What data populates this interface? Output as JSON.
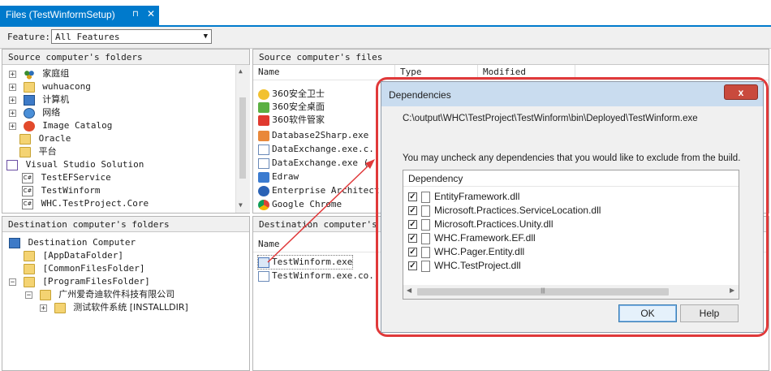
{
  "tab": {
    "title": "Files (TestWinformSetup)",
    "pin": "⊓",
    "close": "✕"
  },
  "feature": {
    "label": "Feature:",
    "value": "All Features"
  },
  "source_folders": {
    "header": "Source computer's folders",
    "items": [
      {
        "label": "家庭组",
        "expand": "+",
        "icon": "homegroup-icon"
      },
      {
        "label": "wuhuacong",
        "expand": "+",
        "icon": "user-icon"
      },
      {
        "label": "计算机",
        "expand": "+",
        "icon": "computer-icon"
      },
      {
        "label": "网络",
        "expand": "+",
        "icon": "network-icon"
      },
      {
        "label": "Image Catalog",
        "expand": "+",
        "icon": "image-catalog-icon"
      },
      {
        "label": "Oracle",
        "expand": "",
        "icon": "folder-icon"
      },
      {
        "label": "平台",
        "expand": "",
        "icon": "folder-icon"
      },
      {
        "label": "Visual Studio Solution",
        "expand": "",
        "icon": "solution-icon"
      },
      {
        "label": "TestEFService",
        "expand": "",
        "icon": "csharp-project-icon"
      },
      {
        "label": "TestWinform",
        "expand": "",
        "icon": "csharp-project-icon"
      },
      {
        "label": "WHC.TestProject.Core",
        "expand": "",
        "icon": "csharp-project-icon"
      }
    ]
  },
  "source_files": {
    "header": "Source computer's files",
    "columns": [
      "Name",
      "Type",
      "Modified"
    ],
    "items": [
      "360安全卫士",
      "360安全桌面",
      "360软件管家",
      "Database2Sharp.exe",
      "DataExchange.exe.c...",
      "DataExchange.exe (...",
      "Edraw",
      "Enterprise Architect",
      "Google Chrome"
    ]
  },
  "dest_folders": {
    "header": "Destination computer's folders",
    "items": [
      {
        "label": "Destination Computer",
        "icon": "computer-icon"
      },
      {
        "label": "[AppDataFolder]",
        "icon": "folder-icon"
      },
      {
        "label": "[CommonFilesFolder]",
        "icon": "folder-icon"
      },
      {
        "label": "[ProgramFilesFolder]",
        "icon": "folder-icon"
      },
      {
        "label": "广州爱奇迪软件科技有限公司",
        "icon": "folder-icon"
      },
      {
        "label": "测试软件系统 [INSTALLDIR]",
        "icon": "installdir-icon"
      }
    ]
  },
  "dest_files": {
    "header": "Destination computer's fi",
    "columns": [
      "Name"
    ],
    "items": [
      "TestWinform.exe",
      "TestWinform.exe.co..."
    ]
  },
  "dialog": {
    "title": "Dependencies",
    "close": "x",
    "path": "C:\\output\\WHC\\TestProject\\TestWinform\\bin\\Deployed\\TestWinform.exe",
    "message": "You may uncheck any dependencies that you would like to exclude from the build.",
    "list_header": "Dependency",
    "dependencies": [
      {
        "name": "EntityFramework.dll",
        "checked": true
      },
      {
        "name": "Microsoft.Practices.ServiceLocation.dll",
        "checked": true
      },
      {
        "name": "Microsoft.Practices.Unity.dll",
        "checked": true
      },
      {
        "name": "WHC.Framework.EF.dll",
        "checked": true
      },
      {
        "name": "WHC.Pager.Entity.dll",
        "checked": true
      },
      {
        "name": "WHC.TestProject.dll",
        "checked": true
      }
    ],
    "ok": "OK",
    "help": "Help"
  },
  "colors": {
    "accent": "#007acc",
    "annotation": "#e0393a",
    "dialog_title": "#c9dcef"
  }
}
